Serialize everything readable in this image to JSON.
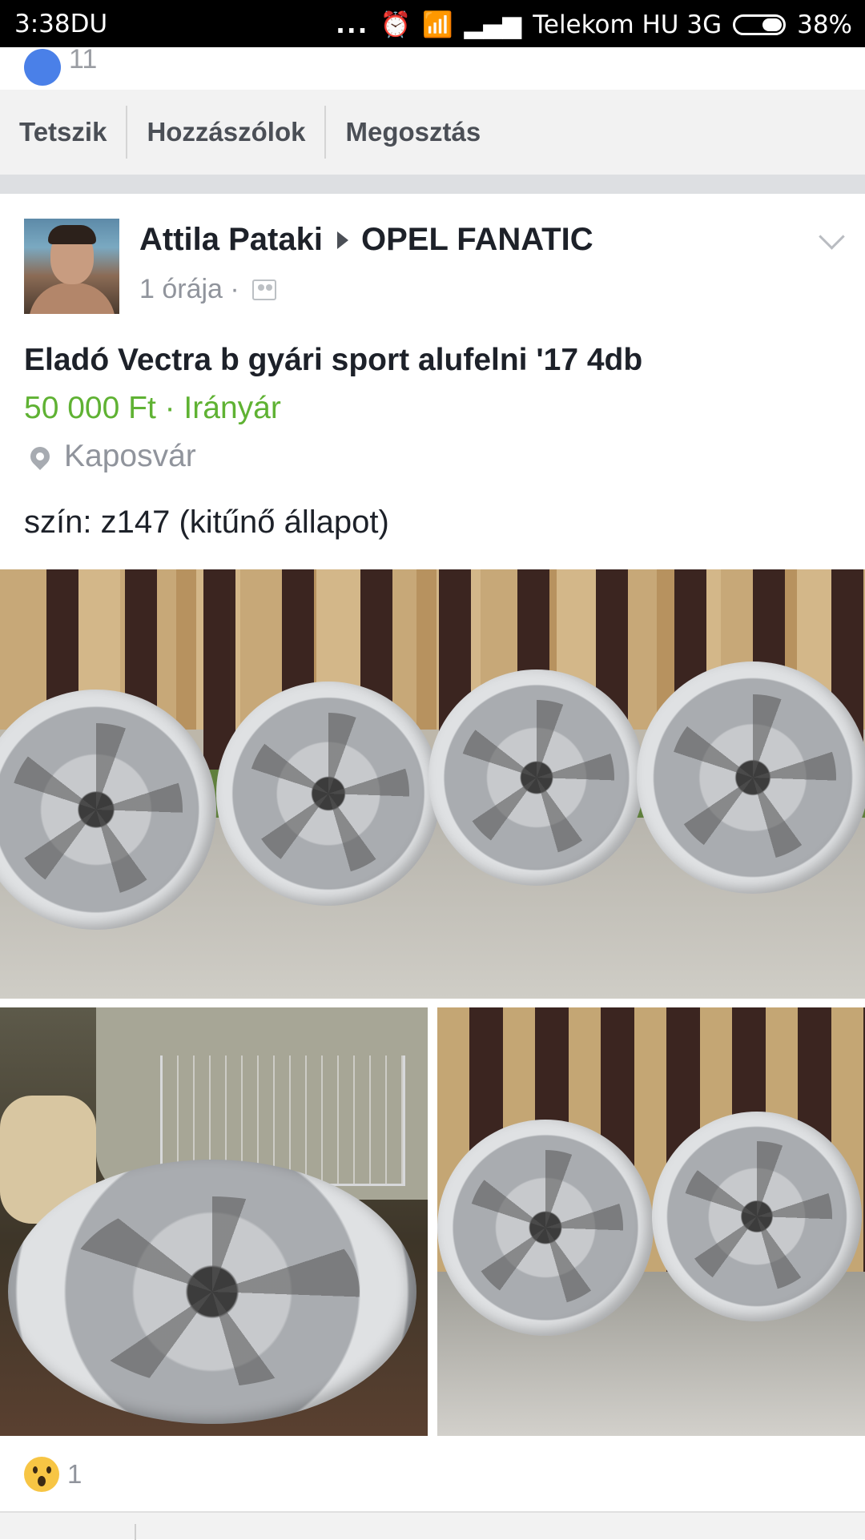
{
  "status_bar": {
    "time": "3:38DU",
    "dots": "...",
    "carrier": "Telekom HU 3G",
    "battery": "38%"
  },
  "previous_post": {
    "like_count": "11",
    "actions": {
      "like": "Tetszik",
      "comment": "Hozzászólok",
      "share": "Megosztás"
    }
  },
  "post": {
    "author": "Attila Pataki",
    "group": "OPEL FANATIC",
    "time": "1 órája ·",
    "title": "Eladó Vectra b gyári sport alufelni '17 4db",
    "price": "50 000 Ft · Irányár",
    "location": "Kaposvár",
    "description": "szín: z147 (kitűnő állapot)",
    "reaction_count": "1"
  }
}
